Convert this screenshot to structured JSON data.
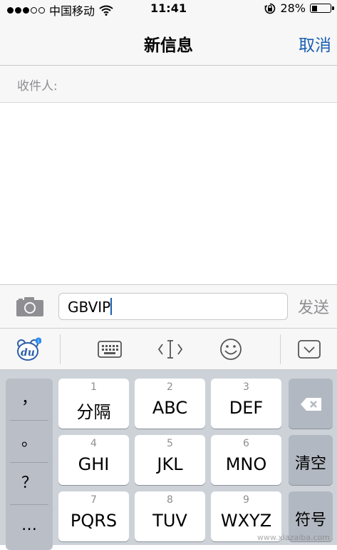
{
  "status_bar": {
    "carrier": "中国移动",
    "time": "11:41",
    "battery": "28%",
    "battery_level": 0.28,
    "signal_bars_filled": 3,
    "signal_bars_total": 5
  },
  "nav": {
    "title": "新信息",
    "cancel": "取消"
  },
  "recipient": {
    "label": "收件人:"
  },
  "compose": {
    "text": "GBVIP",
    "send": "发送"
  },
  "toolbar": {
    "logo_text": "du",
    "icons": [
      "baidu-logo-icon",
      "keyboard-icon",
      "cursor-icon",
      "emoji-icon",
      "collapse-keyboard-icon"
    ]
  },
  "keyboard": {
    "punctuation": [
      "，",
      "。",
      "？",
      "…"
    ],
    "keys": [
      {
        "num": "1",
        "label": "分隔"
      },
      {
        "num": "2",
        "label": "ABC"
      },
      {
        "num": "3",
        "label": "DEF"
      },
      {
        "num": "4",
        "label": "GHI"
      },
      {
        "num": "5",
        "label": "JKL"
      },
      {
        "num": "6",
        "label": "MNO"
      },
      {
        "num": "7",
        "label": "PQRS"
      },
      {
        "num": "8",
        "label": "TUV"
      },
      {
        "num": "9",
        "label": "WXYZ"
      }
    ],
    "clear": "清空",
    "symbol": "符号"
  },
  "watermark": "www.xiazaiba.com",
  "colors": {
    "accent": "#1a5fb4",
    "placeholder_gray": "#8e8e93",
    "keyboard_bg": "#cdd1d8"
  }
}
